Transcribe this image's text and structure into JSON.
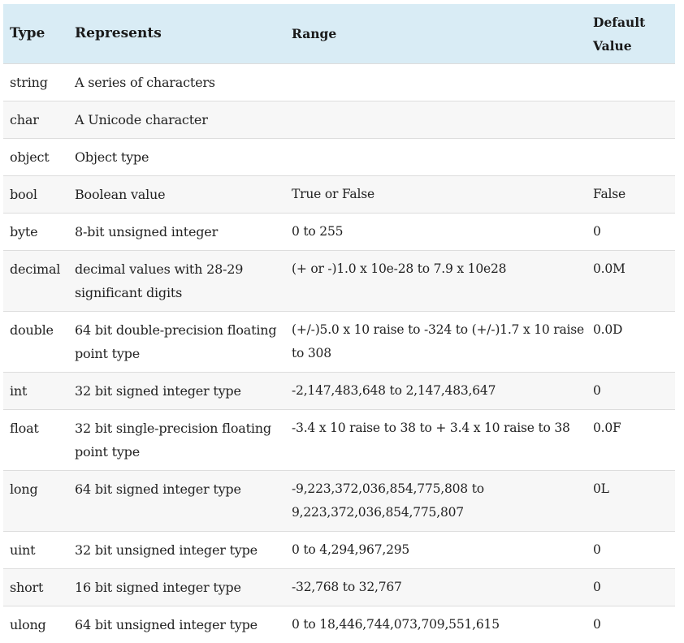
{
  "table": {
    "headers": {
      "type": "Type",
      "represents": "Represents",
      "range": "Range",
      "default_value": "Default Value"
    },
    "rows": [
      {
        "type": "string",
        "represents": "A series of characters",
        "range": "",
        "default": ""
      },
      {
        "type": "char",
        "represents": "A Unicode character",
        "range": "",
        "default": ""
      },
      {
        "type": "object",
        "represents": "Object type",
        "range": "",
        "default": ""
      },
      {
        "type": "bool",
        "represents": "Boolean value",
        "range": "True or False",
        "default": "False"
      },
      {
        "type": "byte",
        "represents": "8-bit unsigned integer",
        "range": "0 to 255",
        "default": "0"
      },
      {
        "type": "decimal",
        "represents": "decimal values with 28-29 significant digits",
        "range": "(+ or -)1.0 x 10e-28 to 7.9 x 10e28",
        "default": "0.0M"
      },
      {
        "type": "double",
        "represents": "64 bit double-precision floating point type",
        "range": "(+/-)5.0 x 10 raise to -324  to (+/-)1.7 x 10 raise to 308",
        "default": "0.0D"
      },
      {
        "type": "int",
        "represents": "32 bit signed integer type",
        "range": "-2,147,483,648 to 2,147,483,647",
        "default": "0"
      },
      {
        "type": "float",
        "represents": "32 bit single-precision floating point type",
        "range": "-3.4 x 10 raise to 38  to + 3.4 x 10 raise to 38",
        "default": "0.0F"
      },
      {
        "type": "long",
        "represents": "64 bit signed integer type",
        "range": "-9,223,372,036,854,775,808 to 9,223,372,036,854,775,807",
        "default": "0L"
      },
      {
        "type": "uint",
        "represents": "32 bit unsigned integer type",
        "range": "0 to 4,294,967,295",
        "default": "0"
      },
      {
        "type": "short",
        "represents": "16 bit signed integer type",
        "range": "-32,768 to 32,767",
        "default": "0"
      },
      {
        "type": "ulong",
        "represents": "64 bit unsigned integer type",
        "range": "0 to 18,446,744,073,709,551,615",
        "default": "0"
      }
    ]
  }
}
